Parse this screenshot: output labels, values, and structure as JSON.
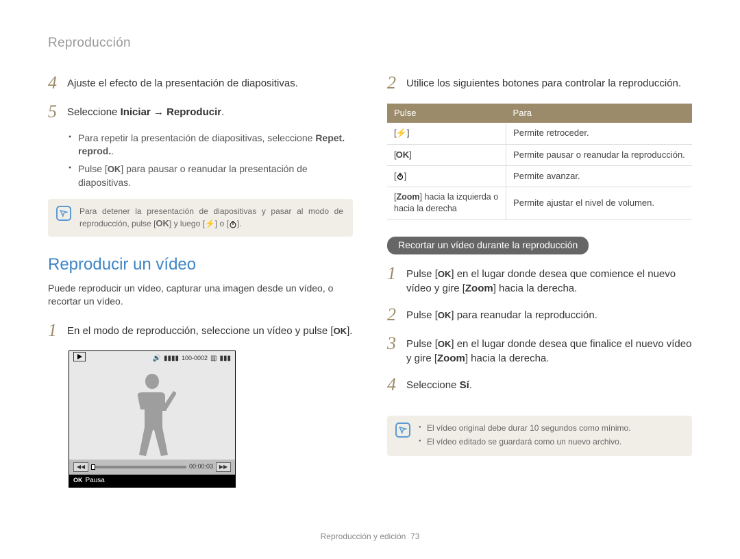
{
  "header": "Reproducción",
  "left": {
    "step4": "Ajuste el efecto de la presentación de diapositivas.",
    "step5_pre": "Seleccione ",
    "step5_b1": "Iniciar",
    "step5_arrow": " → ",
    "step5_b2": "Reproducir",
    "step5_post": ".",
    "bullet1_pre": "Para repetir la presentación de diapositivas, seleccione ",
    "bullet1_b": "Repet. reprod.",
    "bullet1_post": ".",
    "bullet2_pre": "Pulse [",
    "bullet2_ok": "OK",
    "bullet2_post": "] para pausar o reanudar la presentación de diapositivas.",
    "note1_pre": "Para detener la presentación de diapositivas y pasar al modo de reproducción, pulse [",
    "note1_ok": "OK",
    "note1_mid": "] y luego [",
    "note1_or": "] o [",
    "note1_end": "].",
    "section_title": "Reproducir un vídeo",
    "section_desc": "Puede reproducir un vídeo, capturar una imagen desde un vídeo, o recortar un vídeo.",
    "video_step1_pre": "En el modo de reproducción, seleccione un vídeo y pulse [",
    "video_step1_ok": "OK",
    "video_step1_post": "].",
    "screen": {
      "topright": "100-0002",
      "time": "00:00:03",
      "pause": "Pausa"
    }
  },
  "right": {
    "step2": "Utilice los siguientes botones para controlar la reproducción.",
    "th1": "Pulse",
    "th2": "Para",
    "r1c2": "Permite retroceder.",
    "r2c1": "OK",
    "r2c2": "Permite pausar o reanudar la reproducción.",
    "r3c2": "Permite avanzar.",
    "r4c1_pre": "[",
    "r4c1_b": "Zoom",
    "r4c1_post": "] hacia la izquierda o hacia la derecha",
    "r4c2": "Permite ajustar el nivel de volumen.",
    "pill": "Recortar un vídeo durante la reproducción",
    "cut1_pre": "Pulse [",
    "cut1_ok": "OK",
    "cut1_mid": "] en el lugar donde desea que comience el nuevo vídeo y gire [",
    "cut1_b": "Zoom",
    "cut1_post": "] hacia la derecha.",
    "cut2_pre": "Pulse [",
    "cut2_ok": "OK",
    "cut2_post": "] para reanudar la reproducción.",
    "cut3_pre": "Pulse [",
    "cut3_ok": "OK",
    "cut3_mid": "] en el lugar donde desea que finalice el nuevo vídeo y gire [",
    "cut3_b": "Zoom",
    "cut3_post": "] hacia la derecha.",
    "cut4_pre": "Seleccione ",
    "cut4_b": "Sí",
    "cut4_post": ".",
    "note2_b1": "El vídeo original debe durar 10 segundos como mínimo.",
    "note2_b2": "El vídeo editado se guardará como un nuevo archivo."
  },
  "footer_text": "Reproducción y edición",
  "footer_page": "73"
}
